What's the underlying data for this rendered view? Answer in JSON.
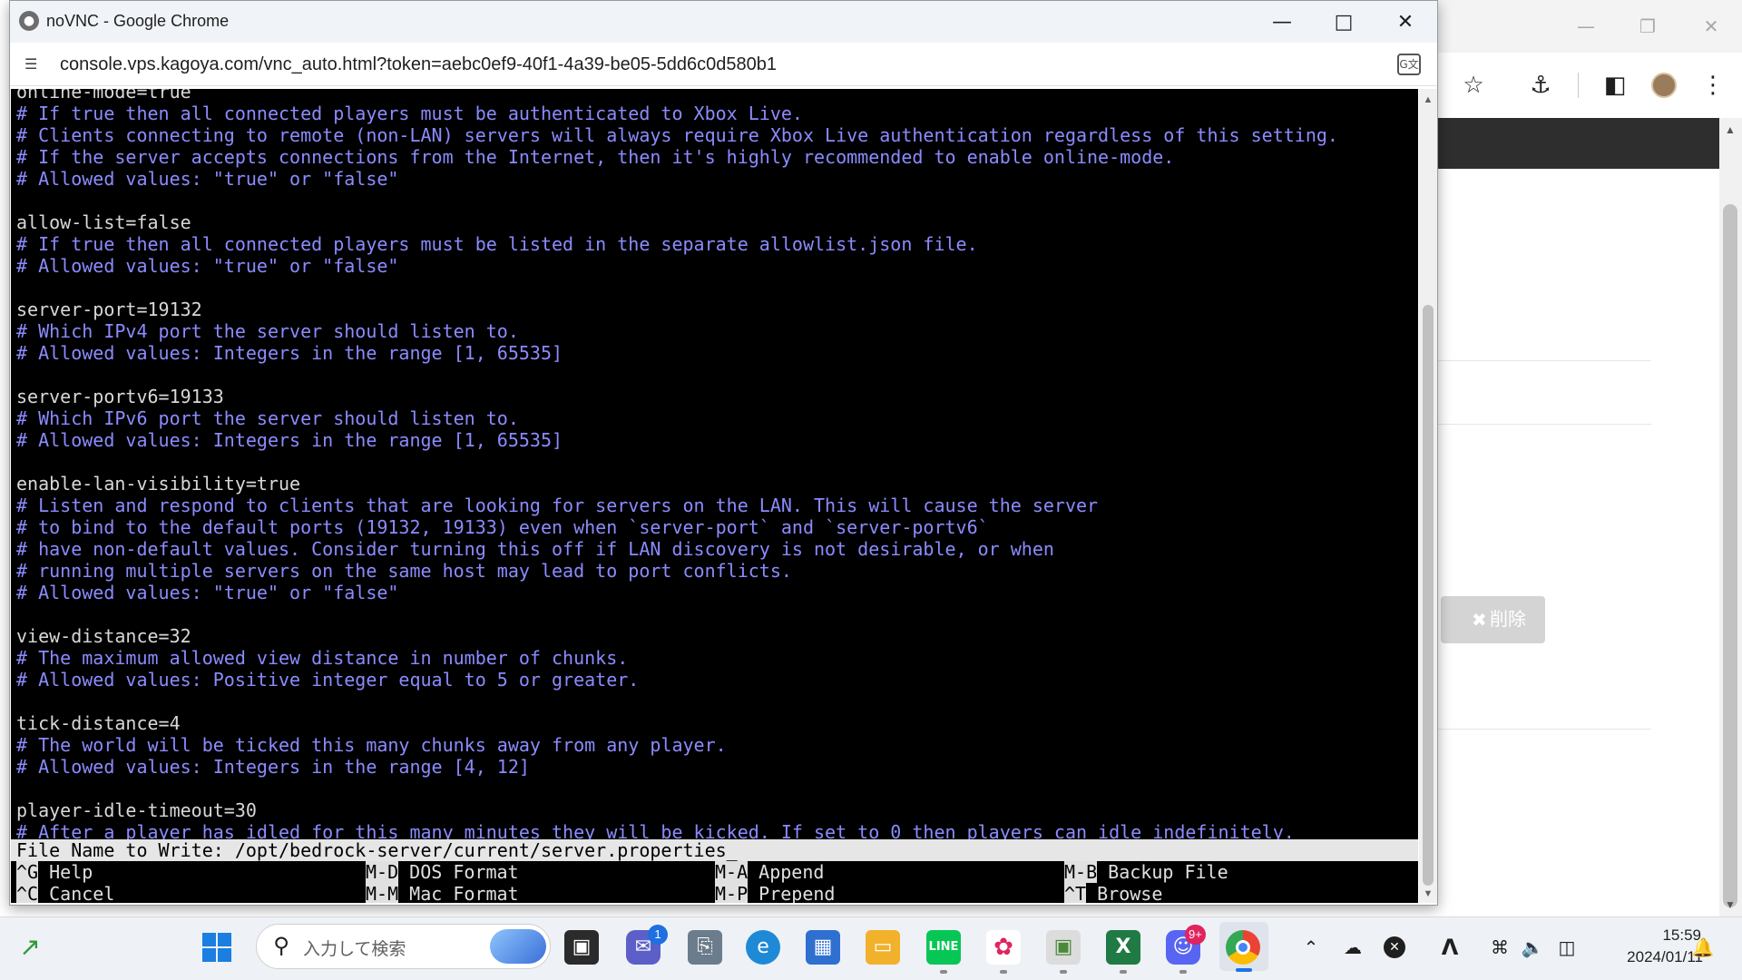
{
  "popup": {
    "title": "noVNC - Google Chrome",
    "url": "console.vps.kagoya.com/vnc_auto.html?token=aebc0ef9-40f1-4a39-be05-5dd6c0d580b1"
  },
  "terminal": {
    "lines": [
      {
        "text": "online-mode=true",
        "kind": "setting"
      },
      {
        "text": "# If true then all connected players must be authenticated to Xbox Live.",
        "kind": "comment"
      },
      {
        "text": "# Clients connecting to remote (non-LAN) servers will always require Xbox Live authentication regardless of this setting.",
        "kind": "comment"
      },
      {
        "text": "# If the server accepts connections from the Internet, then it's highly recommended to enable online-mode.",
        "kind": "comment"
      },
      {
        "text": "# Allowed values: \"true\" or \"false\"",
        "kind": "comment"
      },
      {
        "text": "",
        "kind": "blank"
      },
      {
        "text": "allow-list=false",
        "kind": "setting"
      },
      {
        "text": "# If true then all connected players must be listed in the separate allowlist.json file.",
        "kind": "comment"
      },
      {
        "text": "# Allowed values: \"true\" or \"false\"",
        "kind": "comment"
      },
      {
        "text": "",
        "kind": "blank"
      },
      {
        "text": "server-port=19132",
        "kind": "setting"
      },
      {
        "text": "# Which IPv4 port the server should listen to.",
        "kind": "comment"
      },
      {
        "text": "# Allowed values: Integers in the range [1, 65535]",
        "kind": "comment"
      },
      {
        "text": "",
        "kind": "blank"
      },
      {
        "text": "server-portv6=19133",
        "kind": "setting"
      },
      {
        "text": "# Which IPv6 port the server should listen to.",
        "kind": "comment"
      },
      {
        "text": "# Allowed values: Integers in the range [1, 65535]",
        "kind": "comment"
      },
      {
        "text": "",
        "kind": "blank"
      },
      {
        "text": "enable-lan-visibility=true",
        "kind": "setting"
      },
      {
        "text": "# Listen and respond to clients that are looking for servers on the LAN. This will cause the server",
        "kind": "comment"
      },
      {
        "text": "# to bind to the default ports (19132, 19133) even when `server-port` and `server-portv6`",
        "kind": "comment"
      },
      {
        "text": "# have non-default values. Consider turning this off if LAN discovery is not desirable, or when",
        "kind": "comment"
      },
      {
        "text": "# running multiple servers on the same host may lead to port conflicts.",
        "kind": "comment"
      },
      {
        "text": "# Allowed values: \"true\" or \"false\"",
        "kind": "comment"
      },
      {
        "text": "",
        "kind": "blank"
      },
      {
        "text": "view-distance=32",
        "kind": "setting"
      },
      {
        "text": "# The maximum allowed view distance in number of chunks.",
        "kind": "comment"
      },
      {
        "text": "# Allowed values: Positive integer equal to 5 or greater.",
        "kind": "comment"
      },
      {
        "text": "",
        "kind": "blank"
      },
      {
        "text": "tick-distance=4",
        "kind": "setting"
      },
      {
        "text": "# The world will be ticked this many chunks away from any player.",
        "kind": "comment"
      },
      {
        "text": "# Allowed values: Integers in the range [4, 12]",
        "kind": "comment"
      },
      {
        "text": "",
        "kind": "blank"
      },
      {
        "text": "player-idle-timeout=30",
        "kind": "setting"
      },
      {
        "text": "# After a player has idled for this many minutes they will be kicked. If set to 0 then players can idle indefinitely.",
        "kind": "comment"
      }
    ],
    "prompt": "File Name to Write: /opt/bedrock-server/current/server.properties_",
    "shortcuts": [
      {
        "key": "^G",
        "label": " Help"
      },
      {
        "key": "^C",
        "label": " Cancel"
      },
      {
        "key": "M-D",
        "label": " DOS Format"
      },
      {
        "key": "M-M",
        "label": " Mac Format"
      },
      {
        "key": "M-A",
        "label": " Append"
      },
      {
        "key": "M-P",
        "label": " Prepend"
      },
      {
        "key": "M-B",
        "label": " Backup File"
      },
      {
        "key": "^T",
        "label": " Browse"
      }
    ]
  },
  "background": {
    "delete_button": "削除"
  },
  "taskbar": {
    "search_placeholder": "入力して検索",
    "badges": {
      "teams": "1",
      "discord": "9+"
    },
    "clock_time": "15:59",
    "clock_date": "2024/01/11"
  },
  "colors": {
    "terminal_bg": "#000000",
    "comment_text": "#8b8bff",
    "setting_text": "#d8d8d8",
    "taskbar_bg": "#eef1f6"
  }
}
